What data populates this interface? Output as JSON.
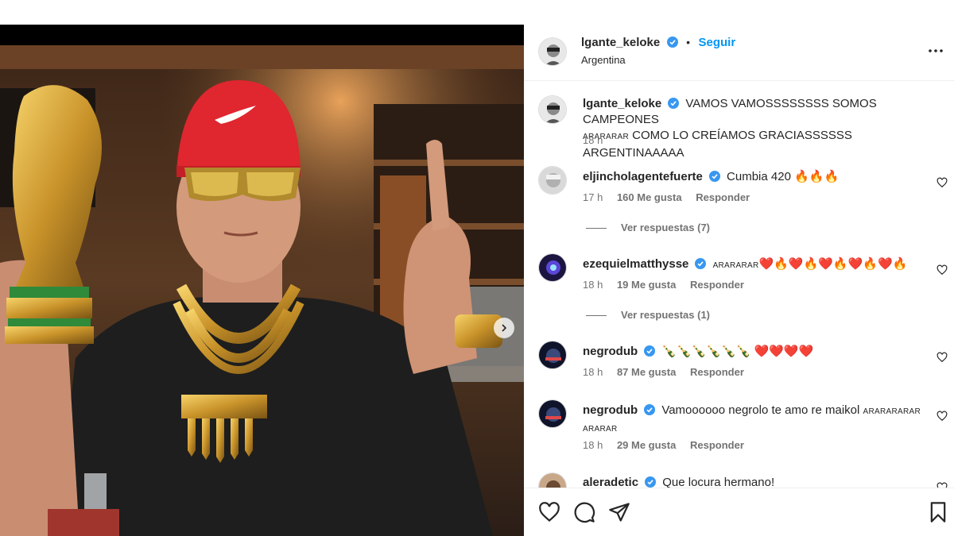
{
  "post": {
    "author": "lgante_keloke",
    "follow_label": "Seguir",
    "separator": "•",
    "location": "Argentina",
    "caption_main": "VAMOS VAMOSSSSSSSS SOMOS CAMPEONES",
    "caption_small": "ARARARAR",
    "caption_rest": "COMO LO CREÍAMOS GRACIASSSSSS ARGENTINAAAAA",
    "caption_time": "18 h"
  },
  "comments": [
    {
      "user": "eljincholagentefuerte",
      "text": "Cumbia 420 🔥🔥🔥",
      "time": "17 h",
      "likes": "160 Me gusta",
      "reply": "Responder",
      "view_replies": "Ver respuestas (7)"
    },
    {
      "user": "ezequielmatthysse",
      "small": "ARARARAR",
      "text": "❤️🔥❤️🔥❤️🔥❤️🔥❤️🔥",
      "time": "18 h",
      "likes": "19 Me gusta",
      "reply": "Responder",
      "view_replies": "Ver respuestas (1)"
    },
    {
      "user": "negrodub",
      "text": "🍾🍾🍾🍾🍾🍾 ❤️❤️❤️❤️",
      "time": "18 h",
      "likes": "87 Me gusta",
      "reply": "Responder"
    },
    {
      "user": "negrodub",
      "text": "Vamoooooo negrolo te amo re maikol",
      "small": "ARARARARAR",
      "small2": "ARARAR",
      "time": "18 h",
      "likes": "29 Me gusta",
      "reply": "Responder"
    },
    {
      "user": "aleradetic",
      "text": "Que locura hermano!"
    }
  ],
  "colors": {
    "accent": "#0095f6",
    "verified": "#3897f0",
    "secondary_text": "#737373"
  },
  "icons": {
    "more": "more-options-icon",
    "like": "heart-icon",
    "comment": "comment-icon",
    "share": "share-icon",
    "save": "bookmark-icon",
    "next": "chevron-right-icon"
  }
}
